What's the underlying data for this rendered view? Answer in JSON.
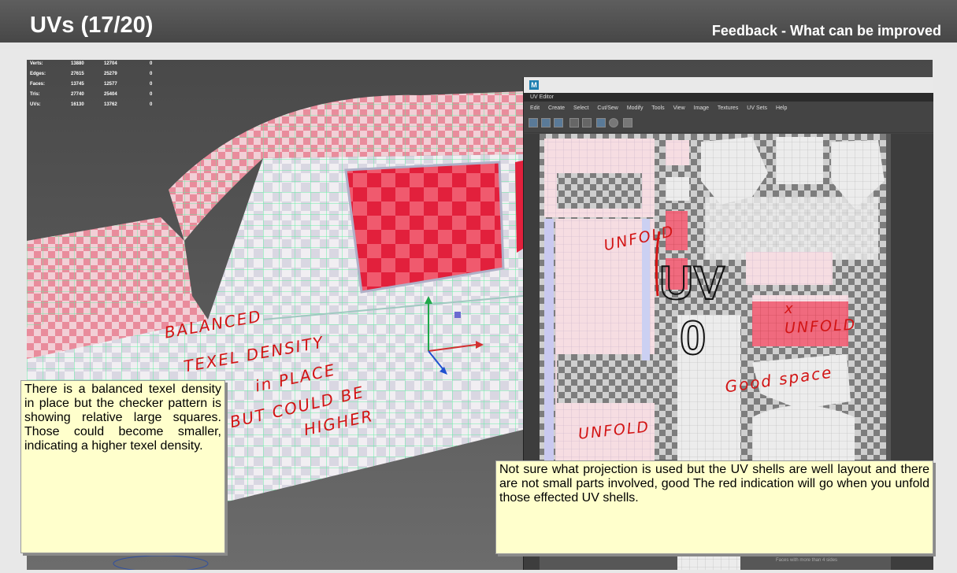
{
  "slide": {
    "title": "UVs (17/20)",
    "subtitle": "Feedback - What can be improved"
  },
  "stats": [
    {
      "label": "Verts:",
      "v1": "13880",
      "v2": "12704",
      "v3": "0"
    },
    {
      "label": "Edges:",
      "v1": "27615",
      "v2": "25279",
      "v3": "0"
    },
    {
      "label": "Faces:",
      "v1": "13745",
      "v2": "12577",
      "v3": "0"
    },
    {
      "label": "Tris:",
      "v1": "27740",
      "v2": "25404",
      "v3": "0"
    },
    {
      "label": "UVs:",
      "v1": "16130",
      "v2": "13762",
      "v3": "0"
    }
  ],
  "uv_editor": {
    "tab_label": "UV Editor",
    "menu": [
      "Edit",
      "Create",
      "Select",
      "Cut/Sew",
      "Modify",
      "Tools",
      "View",
      "Image",
      "Textures",
      "UV Sets",
      "Help"
    ],
    "footer_items": [
      "4-sided faces",
      "Faces with more than 4 sides"
    ]
  },
  "annotations": {
    "left_lines": [
      "BALANCED",
      "TEXEL DENSITY",
      "in PLACE",
      "BUT COULD BE",
      "HIGHER"
    ],
    "unfold_1": "UNFOLD",
    "unfold_2": "UNFOLD",
    "unfold_3": "UNFOLD",
    "x_mark": "x",
    "good_space": "Good space"
  },
  "feedback": {
    "left": "There is a balanced texel density in place but the checker pattern is showing relative large squares. Those could become smaller, indicating a higher texel density.",
    "right": "Not sure what projection is used but the UV shells are well layout and there are not small parts involved, good The red indication will go when you unfold those effected UV shells."
  },
  "colors": {
    "header": "#545454",
    "annotation_red": "#d21414",
    "note_bg": "#ffffcc",
    "wire_green": "#5cf0a0",
    "checker_red": "#e8344c"
  }
}
